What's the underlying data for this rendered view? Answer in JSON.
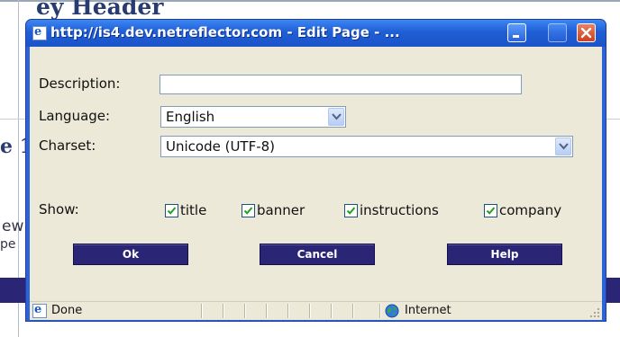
{
  "background": {
    "heading": "ey Header",
    "fragment_1": "e 1",
    "fragment_2": "ew",
    "fragment_3": "pe"
  },
  "window": {
    "title": "http://is4.dev.netreflector.com - Edit Page - ...",
    "icon": "ie-page-icon",
    "controls": [
      "minimize-icon",
      "maximize-icon",
      "close-icon"
    ]
  },
  "form": {
    "description_label": "Description:",
    "description_value": "",
    "language_label": "Language:",
    "language_value": "English",
    "charset_label": "Charset:",
    "charset_value": "Unicode (UTF-8)",
    "show_label": "Show:",
    "show_options": [
      {
        "label": "title",
        "checked": true
      },
      {
        "label": "banner",
        "checked": true
      },
      {
        "label": "instructions",
        "checked": true
      },
      {
        "label": "company",
        "checked": true
      }
    ]
  },
  "buttons": {
    "ok": "Ok",
    "cancel": "Cancel",
    "help": "Help"
  },
  "status": {
    "text": "Done",
    "zone": "Internet"
  },
  "colors": {
    "titlebar": "#2d63d9",
    "button_bg": "#2b2576",
    "dialog_bg": "#ece9d8"
  }
}
